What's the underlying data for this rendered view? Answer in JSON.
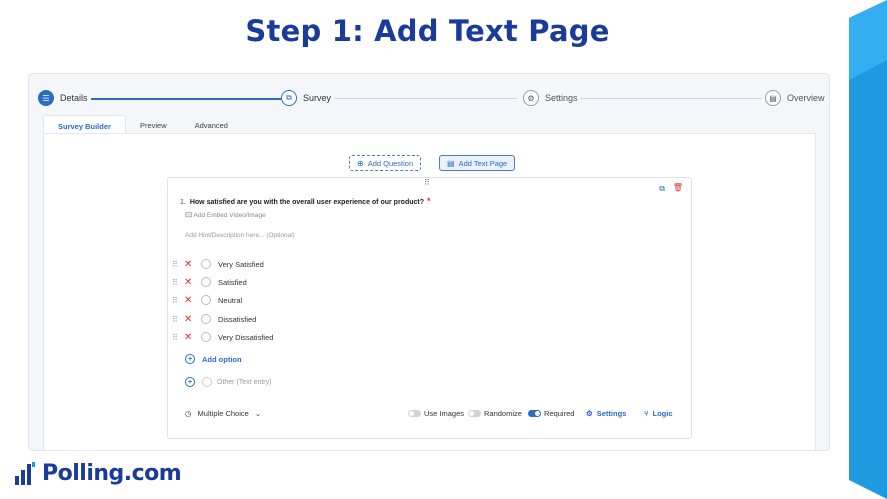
{
  "slide": {
    "title": "Step 1: Add Text Page"
  },
  "stepper": {
    "steps": [
      {
        "label": "Details",
        "icon": "list-icon"
      },
      {
        "label": "Survey",
        "icon": "survey-icon"
      },
      {
        "label": "Settings",
        "icon": "gear-icon"
      },
      {
        "label": "Overview",
        "icon": "document-icon"
      }
    ]
  },
  "tabs": [
    "Survey Builder",
    "Preview",
    "Advanced"
  ],
  "builder": {
    "add_question": "Add Question",
    "add_text_page": "Add Text Page",
    "question": {
      "number": "1.",
      "title": "How satisfied are you with the overall user experience of our product?",
      "required_mark": "*",
      "embed": "Add Embed Video/Image",
      "hint_placeholder": "Add Hint/Description here... (Optional)",
      "options": [
        "Very Satisfied",
        "Satisfied",
        "Neutral",
        "Dissatisfied",
        "Very Dissatisfied"
      ],
      "add_option": "Add option",
      "other": "Other (Text entry)"
    },
    "footer": {
      "type": "Multiple Choice",
      "use_images": "Use Images",
      "randomize": "Randomize",
      "required": "Required",
      "settings": "Settings",
      "logic": "Logic",
      "use_images_on": false,
      "randomize_on": false,
      "required_on": true
    }
  },
  "brand": {
    "name": "Polling.com",
    "color": "#1a3b9a",
    "accent": "#2b6cc4"
  }
}
